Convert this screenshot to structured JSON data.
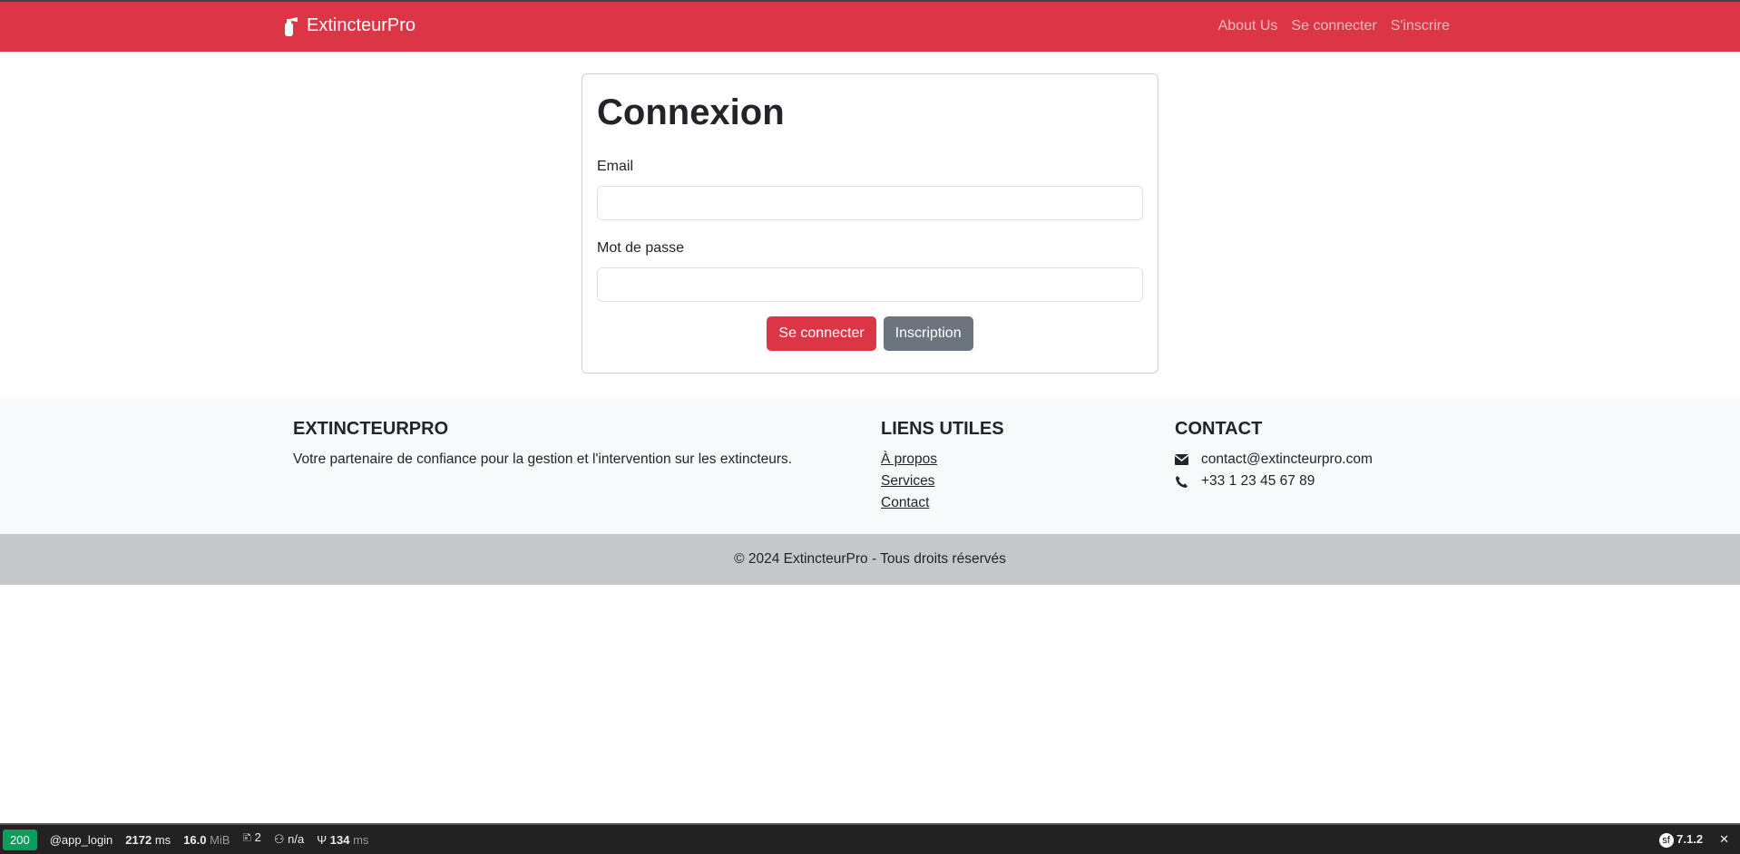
{
  "navbar": {
    "brand": "ExtincteurPro",
    "links": [
      "About Us",
      "Se connecter",
      "S'inscrire"
    ],
    "color": "#dc3545"
  },
  "login": {
    "title": "Connexion",
    "email_label": "Email",
    "email_value": "",
    "password_label": "Mot de passe",
    "password_value": "",
    "submit": "Se connecter",
    "register": "Inscription"
  },
  "footer": {
    "about": {
      "title": "EXTINCTEURPRO",
      "text": "Votre partenaire de confiance pour la gestion et l'intervention sur les extincteurs."
    },
    "links": {
      "title": "LIENS UTILES",
      "items": [
        "À propos",
        "Services",
        "Contact"
      ]
    },
    "contact": {
      "title": "CONTACT",
      "email": "contact@extincteurpro.com",
      "phone": "+33 1 23 45 67 89"
    },
    "copyright": "© 2024 ExtincteurPro - Tous droits réservés"
  },
  "toolbar": {
    "status": "200",
    "route": "@app_login",
    "time": "2172",
    "time_unit": "ms",
    "memory": "16.0",
    "memory_unit": "MiB",
    "logs": "2",
    "user": "n/a",
    "twig": "134",
    "twig_unit": "ms",
    "version": "7.1.2"
  }
}
